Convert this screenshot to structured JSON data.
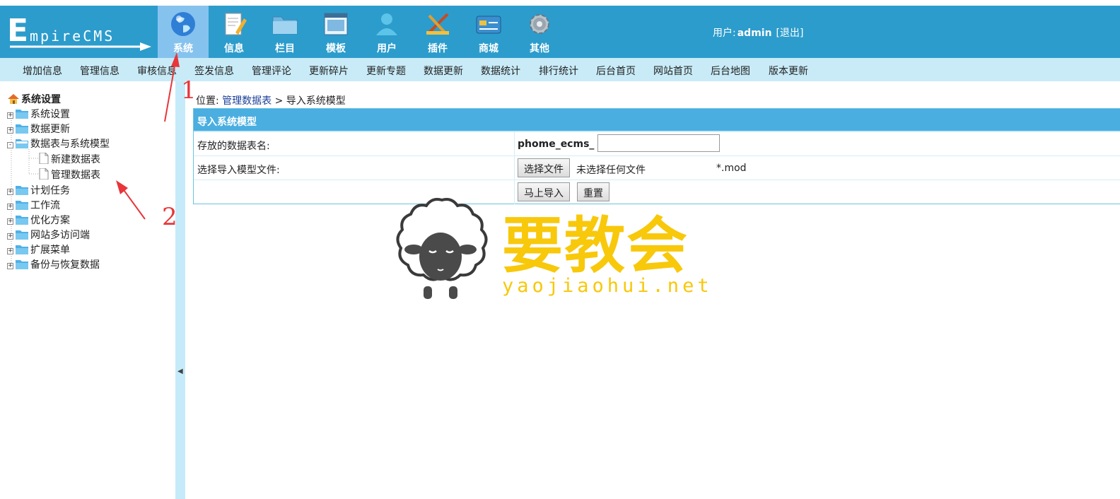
{
  "header": {
    "logo_text": "EmpireCMS",
    "nav": [
      {
        "label": "系统",
        "icon": "globe-icon",
        "active": true
      },
      {
        "label": "信息",
        "icon": "document-edit-icon"
      },
      {
        "label": "栏目",
        "icon": "folder-icon"
      },
      {
        "label": "模板",
        "icon": "window-icon"
      },
      {
        "label": "用户",
        "icon": "user-icon"
      },
      {
        "label": "插件",
        "icon": "tools-icon"
      },
      {
        "label": "商城",
        "icon": "card-icon"
      },
      {
        "label": "其他",
        "icon": "gear-icon"
      }
    ],
    "user_label": "用户:",
    "username": "admin",
    "logout": "[退出]"
  },
  "menubar": [
    "增加信息",
    "管理信息",
    "审核信息",
    "签发信息",
    "管理评论",
    "更新碎片",
    "更新专题",
    "数据更新",
    "数据统计",
    "排行统计",
    "后台首页",
    "网站首页",
    "后台地图",
    "版本更新"
  ],
  "sidebar": {
    "title": "系统设置",
    "items": [
      {
        "label": "系统设置",
        "state": "+"
      },
      {
        "label": "数据更新",
        "state": "+"
      },
      {
        "label": "数据表与系统模型",
        "state": "-"
      },
      {
        "label": "新建数据表",
        "child": true
      },
      {
        "label": "管理数据表",
        "child": true
      },
      {
        "label": "计划任务",
        "state": "+"
      },
      {
        "label": "工作流",
        "state": "+"
      },
      {
        "label": "优化方案",
        "state": "+"
      },
      {
        "label": "网站多访问端",
        "state": "+"
      },
      {
        "label": "扩展菜单",
        "state": "+"
      },
      {
        "label": "备份与恢复数据",
        "state": "+"
      }
    ]
  },
  "content": {
    "breadcrumb_prefix": "位置:",
    "breadcrumb_link": "管理数据表",
    "breadcrumb_current": "> 导入系统模型",
    "form_title": "导入系统模型",
    "table_label": "存放的数据表名:",
    "table_prefix": "phome_ecms_",
    "table_value": "",
    "file_label": "选择导入模型文件:",
    "file_button": "选择文件",
    "file_status": "未选择任何文件",
    "file_ext": "*.mod",
    "submit_button": "马上导入",
    "reset_button": "重置"
  },
  "watermark": {
    "cn": "要教会",
    "en": "yaojiaohui.net"
  },
  "annotations": [
    "1",
    "2"
  ],
  "colors": {
    "header": "#2c9ccc",
    "menubar": "#c8ebf7",
    "form_header": "#4aaee0",
    "annotation": "#e8363a",
    "watermark": "#f8c80a"
  }
}
